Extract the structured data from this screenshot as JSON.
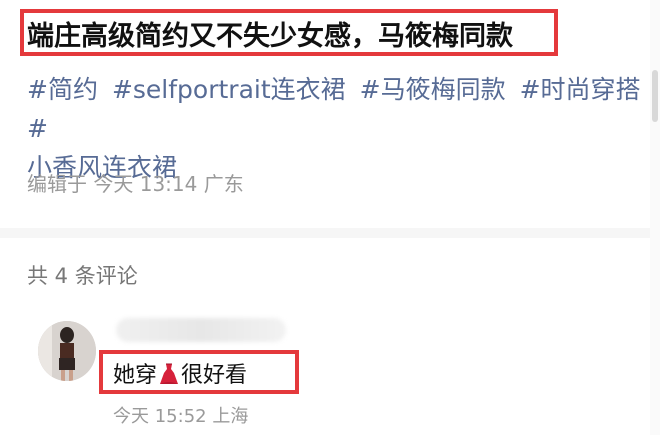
{
  "post": {
    "title": "端庄高级简约又不失少女感，马筱梅同款",
    "tags": [
      "#简约",
      "#selfportrait连衣裙",
      "#马筱梅同款",
      "#时尚穿搭",
      "#",
      "小香风连衣裙"
    ],
    "edit_prefix": "编辑于",
    "edit_time": "今天 13:14",
    "edit_location": "广东"
  },
  "comments_section": {
    "count_text": "共 4 条评论"
  },
  "comment": {
    "text_before_icon": "她穿",
    "icon": "dress-icon",
    "text_after_icon": "很好看",
    "time": "今天 15:52",
    "location": "上海"
  },
  "colors": {
    "highlight_border": "#e4393c",
    "tag_color": "#576b95",
    "meta_color": "#9a9a9a",
    "dress_color": "#d6213a"
  }
}
